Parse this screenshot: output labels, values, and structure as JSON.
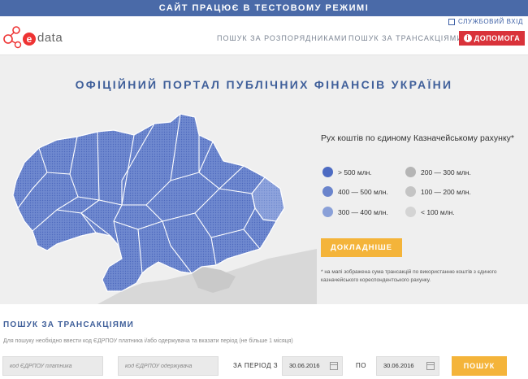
{
  "banner": {
    "text": "САЙТ ПРАЦЮЄ В ТЕСТОВОМУ РЕЖИМІ"
  },
  "header": {
    "logo": {
      "e": "e",
      "text": "data"
    },
    "nav": {
      "distributors": "ПОШУК ЗА РОЗПОРЯДНИКАМИ",
      "transactions": "ПОШУК ЗА ТРАНСАКЦІЯМИ"
    },
    "service_login": "СЛУЖБОВИЙ ВХІД",
    "help": "ДОПОМОГА"
  },
  "hero": {
    "title": "ОФІЦІЙНИЙ ПОРТАЛ ПУБЛІЧНИХ ФІНАНСІВ УКРАЇНИ",
    "legend_title": "Рух коштів по єдиному Казначейському рахунку*",
    "legend": [
      {
        "label": "> 500 млн.",
        "color": "#4d6bc2"
      },
      {
        "label": "200 — 300 млн.",
        "color": "#b5b5b5"
      },
      {
        "label": "400 — 500 млн.",
        "color": "#6a84cc"
      },
      {
        "label": "100 — 200 млн.",
        "color": "#c4c4c4"
      },
      {
        "label": "300 — 400 млн.",
        "color": "#8aa0d8"
      },
      {
        "label": "< 100 млн.",
        "color": "#d4d4d4"
      }
    ],
    "more_button": "ДОКЛАДНІШЕ",
    "footnote": "* на мапі зображена сума трансакцій по використанню коштів з єдиного казначейського кореспондентського рахунку."
  },
  "search": {
    "title": "ПОШУК ЗА ТРАНСАКЦІЯМИ",
    "hint": "Для пошуку необхідно ввести код ЄДРПОУ платника і/або одержувача та вказати період (не більше 1 місяця)",
    "payer_placeholder": "код ЄДРПОУ платника",
    "recipient_placeholder": "код ЄДРПОУ одержувача",
    "period_label": "ЗА ПЕРІОД З",
    "date_from": "30.06.2016",
    "to_label": "ПО",
    "date_to": "30.06.2016",
    "button": "ПОШУК"
  },
  "colors": {
    "accent": "#3f5f9a",
    "banner": "#4a6aa8",
    "button": "#f4b43a",
    "help": "#d9323a",
    "map_region": "#5f79c8"
  }
}
